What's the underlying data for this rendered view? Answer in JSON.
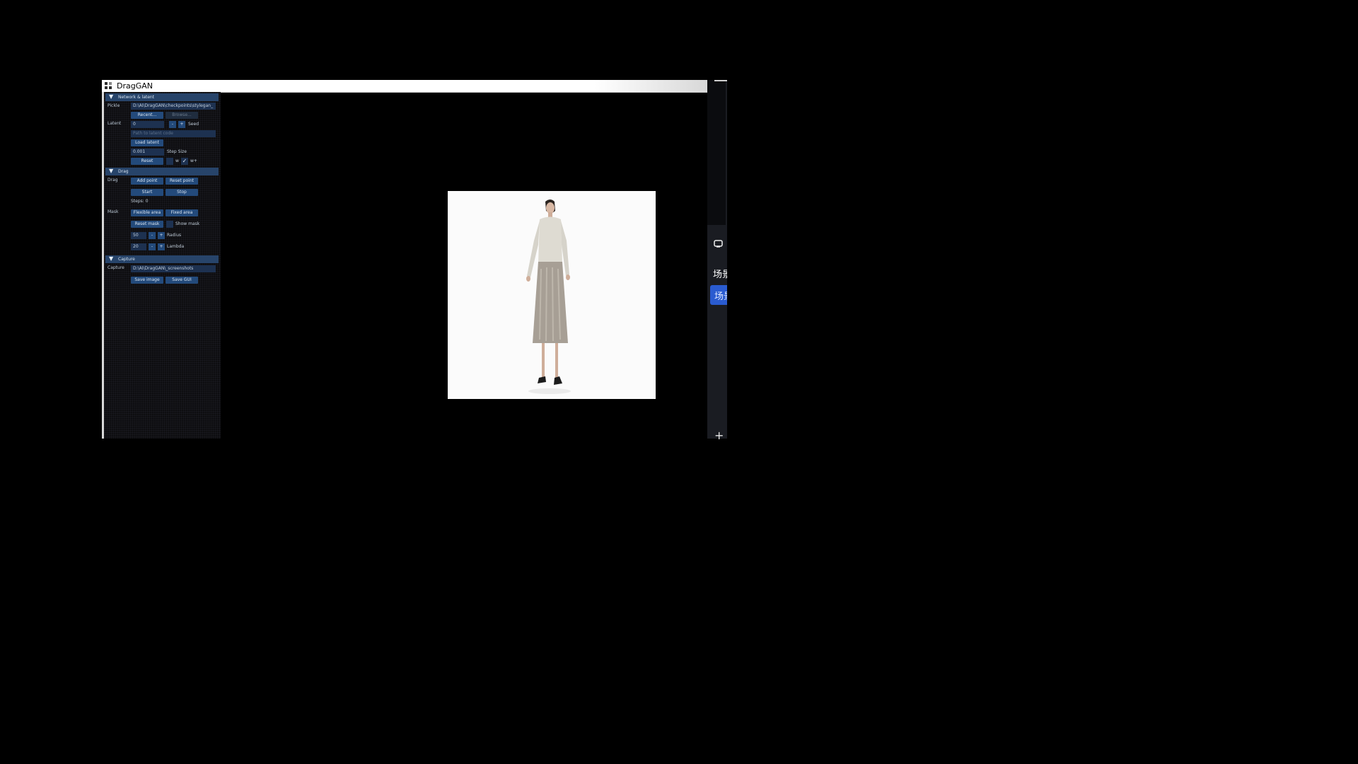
{
  "window": {
    "title": "DragGAN"
  },
  "sections": {
    "network": {
      "header": "Network & latent",
      "pickle_label": "Pickle",
      "pickle_value": "D:\\AI\\DragGAN\\checkpoints\\stylegan_",
      "recent_label": "Recent...",
      "browse_label": "Browse...",
      "latent_label": "Latent",
      "seed_value": "0",
      "minus": "-",
      "plus": "+",
      "seed_label": "Seed",
      "latent_path_placeholder": "Path to latent code",
      "load_latent_label": "Load latent",
      "step_size_value": "0.001",
      "step_size_label": "Step Size",
      "reset_label": "Reset",
      "w_label": "w",
      "wplus_label": "w+",
      "checkmark": "✓"
    },
    "drag": {
      "header": "Drag",
      "drag_label": "Drag",
      "add_point_label": "Add point",
      "reset_point_label": "Reset point",
      "start_label": "Start",
      "stop_label": "Stop",
      "steps_text": "Steps: 0",
      "mask_label": "Mask",
      "flexible_area_label": "Flexible area",
      "fixed_area_label": "Fixed area",
      "reset_mask_label": "Reset mask",
      "show_mask_label": "Show mask",
      "radius_value": "50",
      "radius_label": "Radius",
      "lambda_value": "20",
      "lambda_label": "Lambda",
      "minus": "-",
      "plus": "+"
    },
    "capture": {
      "header": "Capture",
      "capture_label": "Capture",
      "capture_path": "D:\\AI\\DragGAN\\_screenshots",
      "save_image_label": "Save image",
      "save_gui_label": "Save GUI"
    }
  },
  "side_strip": {
    "text_1": "场景",
    "button_text": "场景",
    "plus": "+"
  }
}
